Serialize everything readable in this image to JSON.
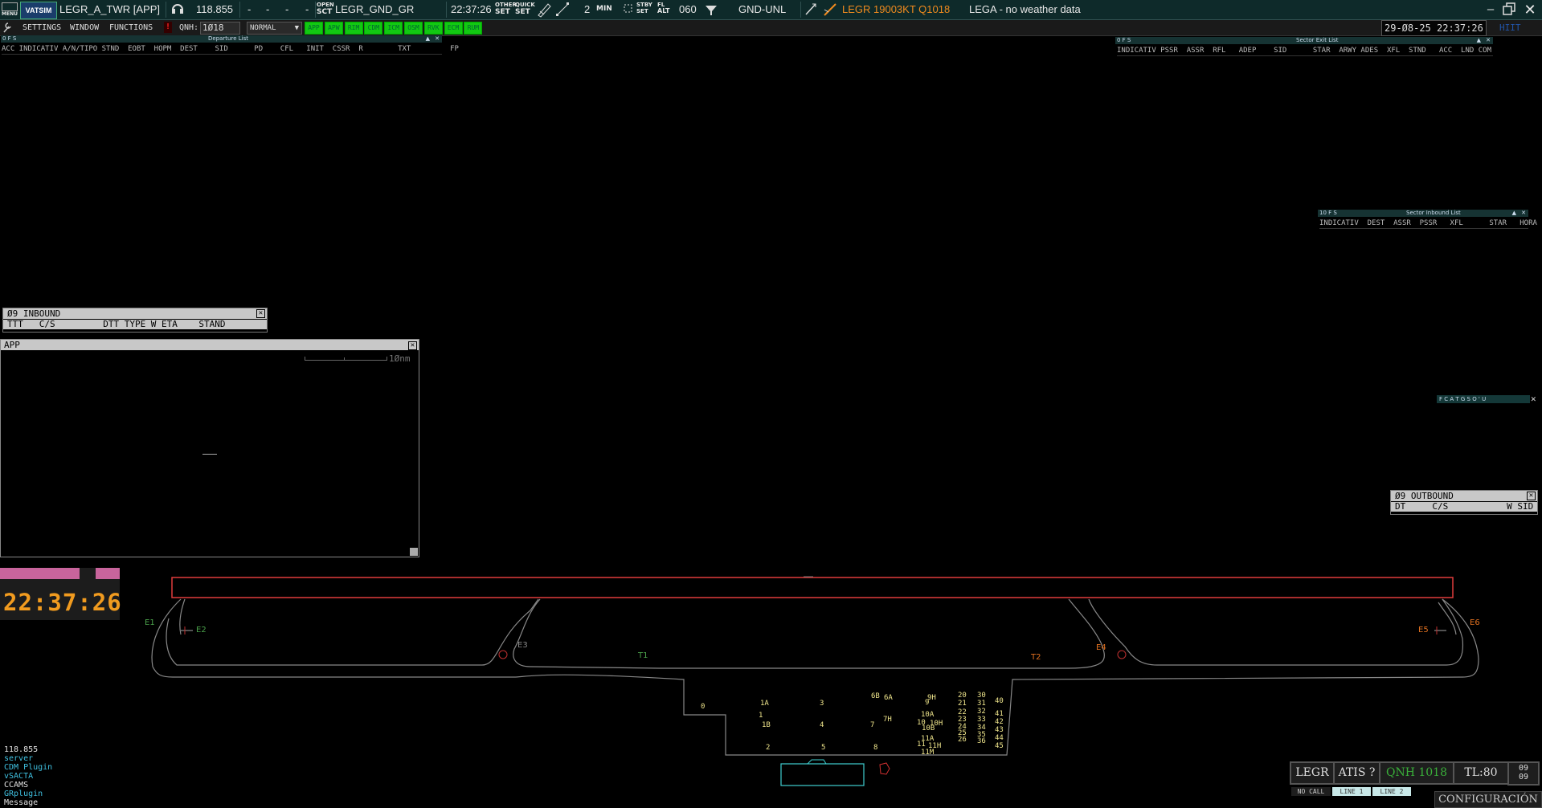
{
  "topbar": {
    "menu_label": "MENU",
    "logo_text": "VATSIM",
    "callsign": "LEGR_A_TWR [APP]",
    "frequency": "118.855",
    "dash1": "-",
    "dash2": "-",
    "dash3": "-",
    "dash4": "-",
    "open_label_top": "OPEN",
    "open_label_bot": "SCT",
    "sector": "LEGR_GND_GR",
    "time": "22:37:26",
    "other_top": "OTHER",
    "other_bot": "SET",
    "quick_top": "QUICK",
    "quick_bot": "SET",
    "count": "2",
    "min_label": "MIN",
    "stby_top": "STBY",
    "stby_bot": "SET",
    "fl_top": "FL",
    "fl_bot": "ALT",
    "fl_value": "060",
    "range": "GND-UNL",
    "metar": "LEGR 19003KT Q1018",
    "weather": "LEGA - no weather data",
    "metar_color": "#f08a1e"
  },
  "bar2": {
    "settings": "SETTINGS",
    "window": "WINDOW",
    "functions": "FUNCTIONS",
    "alert": "!",
    "qnh_label": "QNH:",
    "qnh_value": "1Ø18",
    "mode": "NORMAL",
    "buttons": [
      "APP",
      "APW",
      "RIM",
      "CDM",
      "ICM",
      "OSM",
      "RVK",
      "ECM",
      "RUM"
    ],
    "datetime": "29-Ø8-25 22:37:26",
    "hint": "HIIT"
  },
  "departure_list": {
    "title": "Departure List",
    "flags": "0 F S",
    "columns": "ACC INDICATIV A/N/TIPO STND  EOBT  HOPM  DEST    SID      PD    CFL   INIT  CSSR  R        TXT         FP"
  },
  "sector_exit_list": {
    "title": "Sector Exit List",
    "flags": "0 F S",
    "columns": "INDICATIV PSSR  ASSR  RFL   ADEP    SID      STAR  ARWY ADES  XFL  STND   ACC  LND COM"
  },
  "sector_inbound_list": {
    "title": "Sector Inbound List",
    "flags": "10 F S",
    "columns": "INDICATIV  DEST  ASSR  PSSR   XFL      STAR   HORA"
  },
  "inbound": {
    "title": "Ø9 INBOUND",
    "columns": "TTT   C/S         DTT TYPE W ETA    STAND"
  },
  "outbound": {
    "title": "Ø9 OUTBOUND",
    "columns": "DT     C/S           W SID"
  },
  "app_window": {
    "title": "APP",
    "scale_label": "1Ønm"
  },
  "small_toolbar": "F C A T G S O ' U",
  "clock": "22:37:26",
  "bottom_left": {
    "freq": "118.855",
    "items": [
      "server",
      "CDM Plugin",
      "vSACTA",
      "CCAMS",
      "GRplugin",
      "Message"
    ],
    "colors": [
      "#3fc0e0",
      "#3fc0e0",
      "#3fc0e0",
      "#e0e0e0",
      "#3fc0e0",
      "#e0e0e0"
    ]
  },
  "bottom_right": {
    "airport": "LEGR",
    "atis": "ATIS ?",
    "qnh": "QNH 1018",
    "tl": "TL:80",
    "rwy_top": "09",
    "rwy_bot": "09",
    "no_call": "NO CALL",
    "line1": "LINE 1",
    "line2": "LINE 2",
    "config": "CONFIGURACIÓN"
  },
  "airport_map": {
    "taxiway_labels": [
      "E1",
      "E2",
      "E3",
      "E4",
      "E5",
      "E6",
      "T1",
      "T2"
    ],
    "stands": [
      "0",
      "1A",
      "1",
      "1B",
      "2",
      "3",
      "4",
      "5",
      "6B",
      "6A",
      "7",
      "7H",
      "8",
      "9H",
      "9",
      "10A",
      "10",
      "10H",
      "10B",
      "11A",
      "11",
      "11H",
      "11M",
      "20",
      "21",
      "22",
      "23",
      "24",
      "25",
      "26",
      "30",
      "31",
      "32",
      "33",
      "34",
      "35",
      "36",
      "40",
      "41",
      "42",
      "43",
      "44",
      "45"
    ]
  }
}
